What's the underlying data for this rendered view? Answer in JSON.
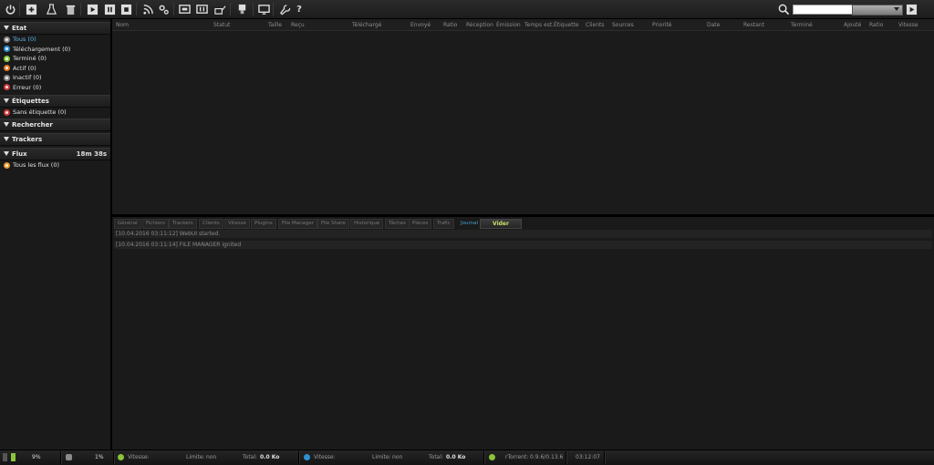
{
  "toolbar": {
    "buttons": [
      {
        "name": "power-icon",
        "title": "power"
      },
      {
        "name": "add-torrent-icon",
        "title": "add"
      },
      {
        "name": "create-torrent-icon",
        "title": "create"
      },
      {
        "name": "delete-icon",
        "title": "remove"
      },
      {
        "name": "start-icon",
        "title": "start"
      },
      {
        "name": "pause-icon",
        "title": "pause"
      },
      {
        "name": "stop-icon",
        "title": "stop"
      },
      {
        "name": "rss-icon",
        "title": "rss"
      },
      {
        "name": "settings-icon",
        "title": "settings"
      },
      {
        "name": "plugin-icon",
        "title": "plugin"
      },
      {
        "name": "plugin2-icon",
        "title": "plugin2"
      },
      {
        "name": "plugin3-icon",
        "title": "plugin3"
      },
      {
        "name": "plugin4-icon",
        "title": "plugin4"
      },
      {
        "name": "screen-icon",
        "title": "screen"
      },
      {
        "name": "tool-icon",
        "title": "tool"
      },
      {
        "name": "help-icon",
        "title": "help"
      }
    ],
    "search_placeholder": ""
  },
  "sidebar": {
    "state_title": "Etat",
    "state_items": [
      {
        "label": "Tous (0)",
        "color": "#8a8a8a"
      },
      {
        "label": "Téléchargement (0)",
        "color": "#2f8fd0"
      },
      {
        "label": "Terminé (0)",
        "color": "#8ac43a"
      },
      {
        "label": "Actif (0)",
        "color": "#e07a2a"
      },
      {
        "label": "Inactif (0)",
        "color": "#8a8a8a"
      },
      {
        "label": "Erreur (0)",
        "color": "#d23a3a"
      }
    ],
    "labels_title": "Étiquettes",
    "labels_items": [
      {
        "label": "Sans étiquette (0)",
        "color": "#d23a3a"
      }
    ],
    "search_title": "Rechercher",
    "trackers_title": "Trackers",
    "feeds_title": "Flux",
    "feeds_timer": "18m 38s",
    "feeds_items": [
      {
        "label": "Tous les flux (0)",
        "color": "#e89a2a"
      }
    ]
  },
  "list": {
    "columns": [
      "Nom",
      "Statut",
      "Taille",
      "Reçu",
      "Téléchargé",
      "Envoyé",
      "Ratio",
      "Réception",
      "Émission",
      "Temps est.",
      "Étiquette",
      "Clients",
      "Sources",
      "Priorité",
      "Date",
      "Restant",
      "Terminé",
      "Ajouté",
      "Ratio",
      "Vitesse"
    ]
  },
  "tabs": [
    "Général",
    "Fichiers",
    "Trackers",
    "Clients",
    "Vitesse",
    "Plugins",
    "File Manager",
    "File Share",
    "Historique",
    "Tâches",
    "Pièces",
    "Trafic",
    "Journal"
  ],
  "clear_button": "Vider",
  "log": [
    "[10.04.2016 03:11:12] WebUI started.",
    "[10.04.2016 03:11:14] FILE MANAGER ignited"
  ],
  "status": {
    "disk_pct": "9%",
    "cpu_pct": "1%",
    "dl_label": "Vitesse:",
    "dl_limit_label": "Limite:",
    "dl_limit": "non",
    "dl_total_label": "Total:",
    "dl_total": "0.0 Ko",
    "ul_label": "Vitesse:",
    "ul_limit_label": "Limite:",
    "ul_limit": "non",
    "ul_total_label": "Total:",
    "ul_total": "0.0 Ko",
    "client_label": "rTorrent:",
    "client_version": "0.9.6/0.13.6",
    "clock": "03:12:07"
  }
}
